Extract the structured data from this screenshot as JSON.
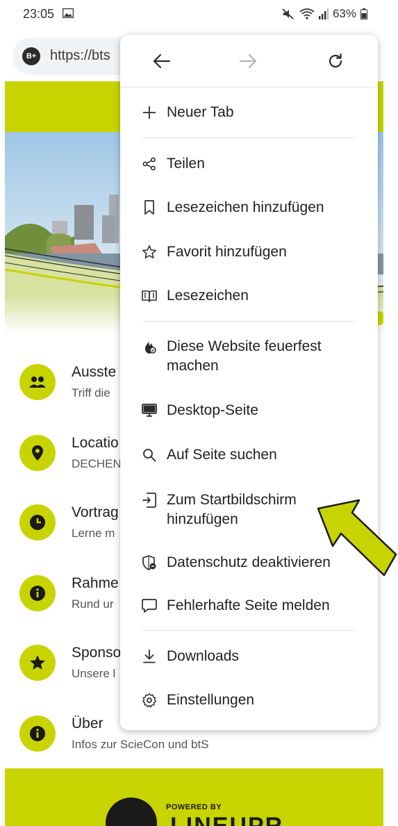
{
  "status": {
    "time": "23:05",
    "battery": "63%"
  },
  "address_bar": {
    "badge": "B+",
    "url": "https://bts"
  },
  "menu": {
    "items": [
      {
        "label": "Neuer Tab",
        "icon": "plus-icon"
      },
      {
        "label": "Teilen",
        "icon": "share-icon"
      },
      {
        "label": "Lesezeichen hinzufügen",
        "icon": "bookmark-add-icon"
      },
      {
        "label": "Favorit hinzufügen",
        "icon": "star-icon"
      },
      {
        "label": "Lesezeichen",
        "icon": "book-icon"
      },
      {
        "label": "Diese Website feuerfest machen",
        "icon": "fire-icon"
      },
      {
        "label": "Desktop-Seite",
        "icon": "desktop-icon"
      },
      {
        "label": "Auf Seite suchen",
        "icon": "search-icon"
      },
      {
        "label": "Zum Startbildschirm hinzufügen",
        "icon": "add-to-home-icon"
      },
      {
        "label": "Datenschutz deaktivieren",
        "icon": "shield-icon"
      },
      {
        "label": "Fehlerhafte Seite melden",
        "icon": "report-icon"
      },
      {
        "label": "Downloads",
        "icon": "download-icon"
      },
      {
        "label": "Einstellungen",
        "icon": "settings-icon"
      }
    ]
  },
  "page_list": [
    {
      "title": "Ausste",
      "subtitle": "Triff die",
      "icon": "people-icon"
    },
    {
      "title": "Locatio",
      "subtitle": "DECHEN",
      "icon": "location-pin-icon"
    },
    {
      "title": "Vortrag",
      "subtitle": "Lerne m",
      "icon": "clock-icon"
    },
    {
      "title": "Rahme",
      "subtitle": "Rund ur",
      "icon": "info-icon"
    },
    {
      "title": "Sponso",
      "subtitle": "Unsere l",
      "icon": "star-filled-icon"
    },
    {
      "title": "Über",
      "subtitle": "Infos zur ScieCon und btS",
      "icon": "info-icon"
    }
  ],
  "footer": {
    "powered_by": "POWERED BY",
    "brand": "LINEUPR"
  },
  "colors": {
    "accent": "#c8d400",
    "annotation_arrow": "#c8d400"
  }
}
